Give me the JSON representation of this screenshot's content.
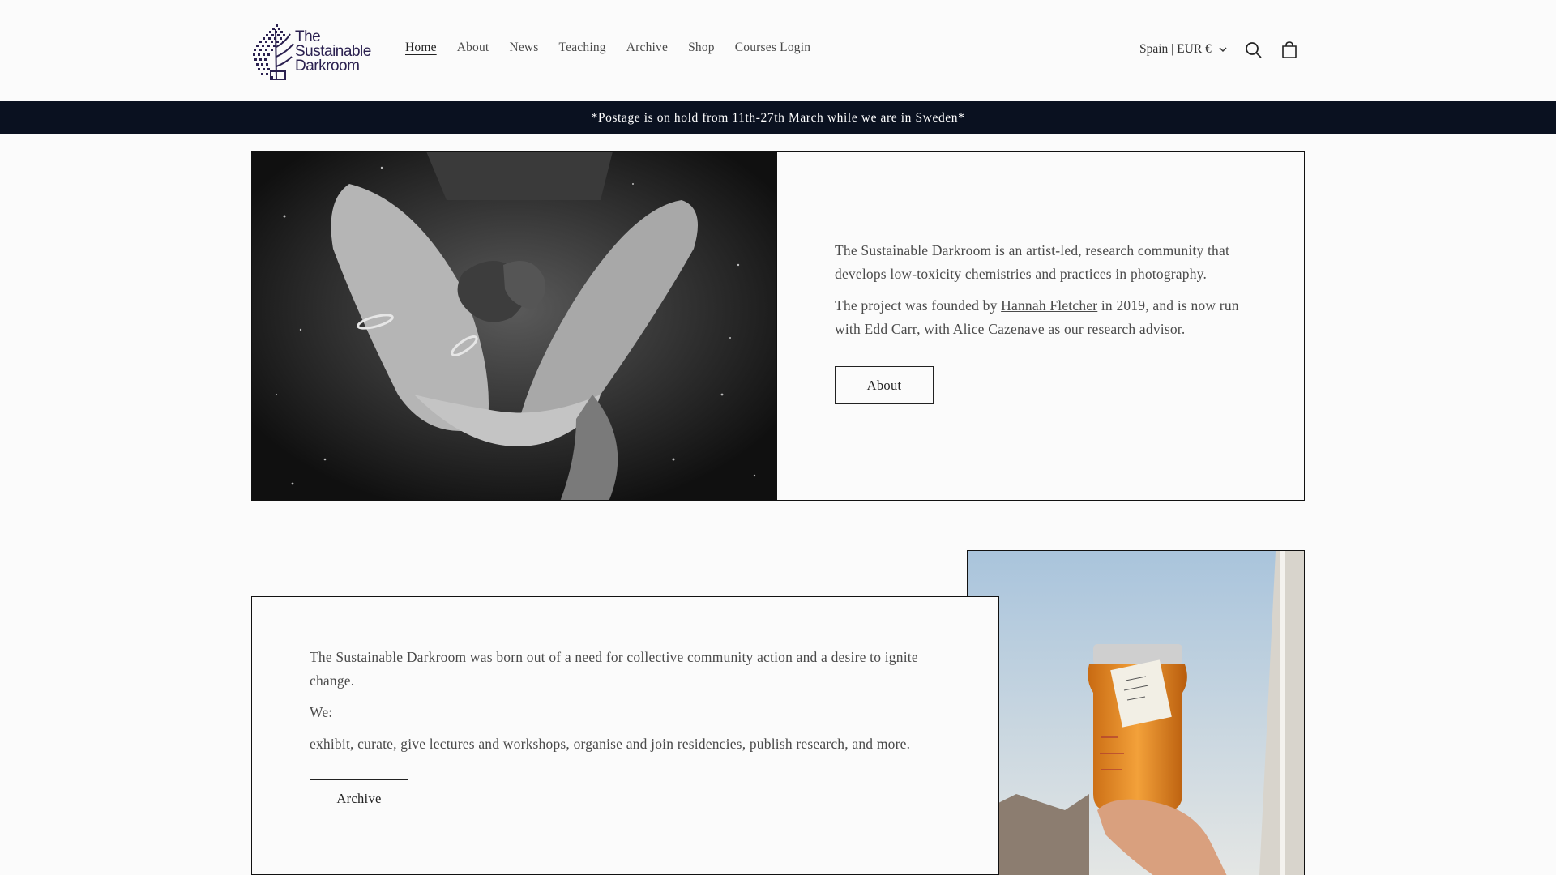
{
  "header": {
    "logo_line1": "The",
    "logo_line2": "Sustainable",
    "logo_line3": "Darkroom",
    "nav": [
      {
        "label": "Home",
        "active": true
      },
      {
        "label": "About"
      },
      {
        "label": "News"
      },
      {
        "label": "Teaching"
      },
      {
        "label": "Archive"
      },
      {
        "label": "Shop"
      },
      {
        "label": "Courses Login"
      }
    ],
    "locale": "Spain | EUR €",
    "icons": [
      "search-icon",
      "cart-icon",
      "chevron-down-icon"
    ]
  },
  "announcement": "*Postage is on hold from 11th-27th March while we are in Sweden*",
  "intro": {
    "paragraph1": "The Sustainable Darkroom is an artist-led, research community that develops low-toxicity chemistries and practices in photography.",
    "p2_part1": "The project was founded by ",
    "link_hannah": "Hannah Fletcher",
    "p2_part2": " in 2019, and is now run with ",
    "link_edd": "Edd Carr",
    "p2_part3": ", with ",
    "link_alice": "Alice Cazenave",
    "p2_part4": " as our research advisor.",
    "button": "About"
  },
  "mission": {
    "paragraph1": "The Sustainable Darkroom was born out of a need for collective community action and a desire to ignite change.",
    "paragraph2": "We:",
    "paragraph3": "exhibit, curate, give lectures and workshops, organise and join residencies, publish research, and more.",
    "button": "Archive"
  },
  "images": {
    "hands_photo": "black-and-white photo of cupped hands holding a leaf",
    "jar_photo": "hand holding a glass jar of amber developer"
  },
  "colors": {
    "background": "#fbfbfb",
    "announcement_bg": "#0a1120",
    "text": "#4a4a4a",
    "logo": "#2b2150"
  }
}
